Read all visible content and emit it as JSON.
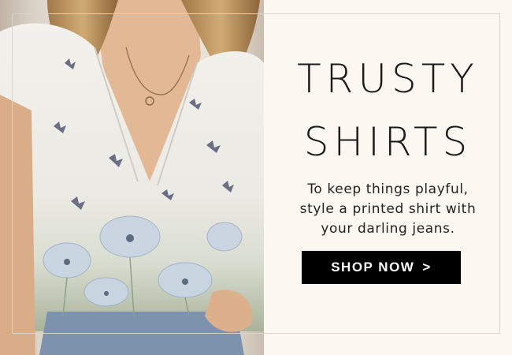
{
  "banner": {
    "title_line1": "TRUSTY",
    "title_line2": "SHIRTS",
    "description": [
      "To keep things playful,",
      "style a printed shirt with",
      "your darling jeans."
    ],
    "cta_label": "SHOP NOW",
    "cta_arrow": ">"
  },
  "colors": {
    "background": "#fcf8f1",
    "button": "#000000",
    "button_text": "#ffffff",
    "text": "#1a1a1a"
  },
  "image": {
    "subject": "model-wearing-white-butterfly-print-shirt-photo"
  }
}
